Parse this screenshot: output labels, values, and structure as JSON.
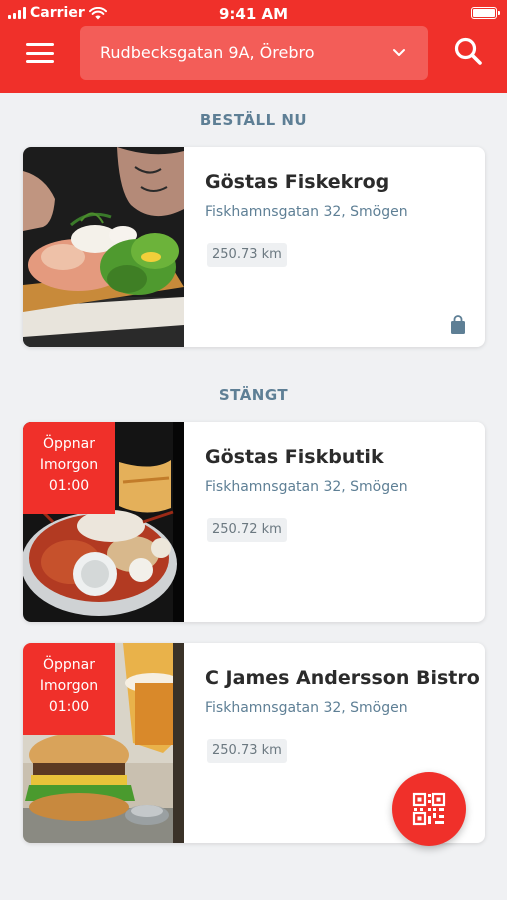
{
  "status_bar": {
    "carrier": "Carrier",
    "time": "9:41 AM"
  },
  "header": {
    "location": "Rudbecksgatan 9A, Örebro",
    "menu_icon": "hamburger-menu-icon",
    "search_icon": "search-icon",
    "chevron_icon": "chevron-down-icon"
  },
  "sections": {
    "order_now": "BESTÄLL NU",
    "closed": "STÄNGT"
  },
  "restaurants": [
    {
      "name": "Göstas Fiskekrog",
      "address": "Fiskhamnsgatan 32, Smögen",
      "distance": "250.73 km",
      "icon": "shopping-bag-icon"
    },
    {
      "name": "Göstas Fiskbutik",
      "address": "Fiskhamnsgatan 32, Smögen",
      "distance": "250.72 km",
      "badge": {
        "line1": "Öppnar",
        "line2": "Imorgon",
        "line3": "01:00"
      }
    },
    {
      "name": "C James Andersson Bistro",
      "address": "Fiskhamnsgatan 32, Smögen",
      "distance": "250.73 km",
      "badge": {
        "line1": "Öppnar",
        "line2": "Imorgon",
        "line3": "01:00"
      }
    }
  ],
  "fab": {
    "icon": "qr-code-icon"
  },
  "colors": {
    "brand_red": "#f0302a",
    "section_title": "#5e7f95",
    "background": "#f0f1f3"
  }
}
